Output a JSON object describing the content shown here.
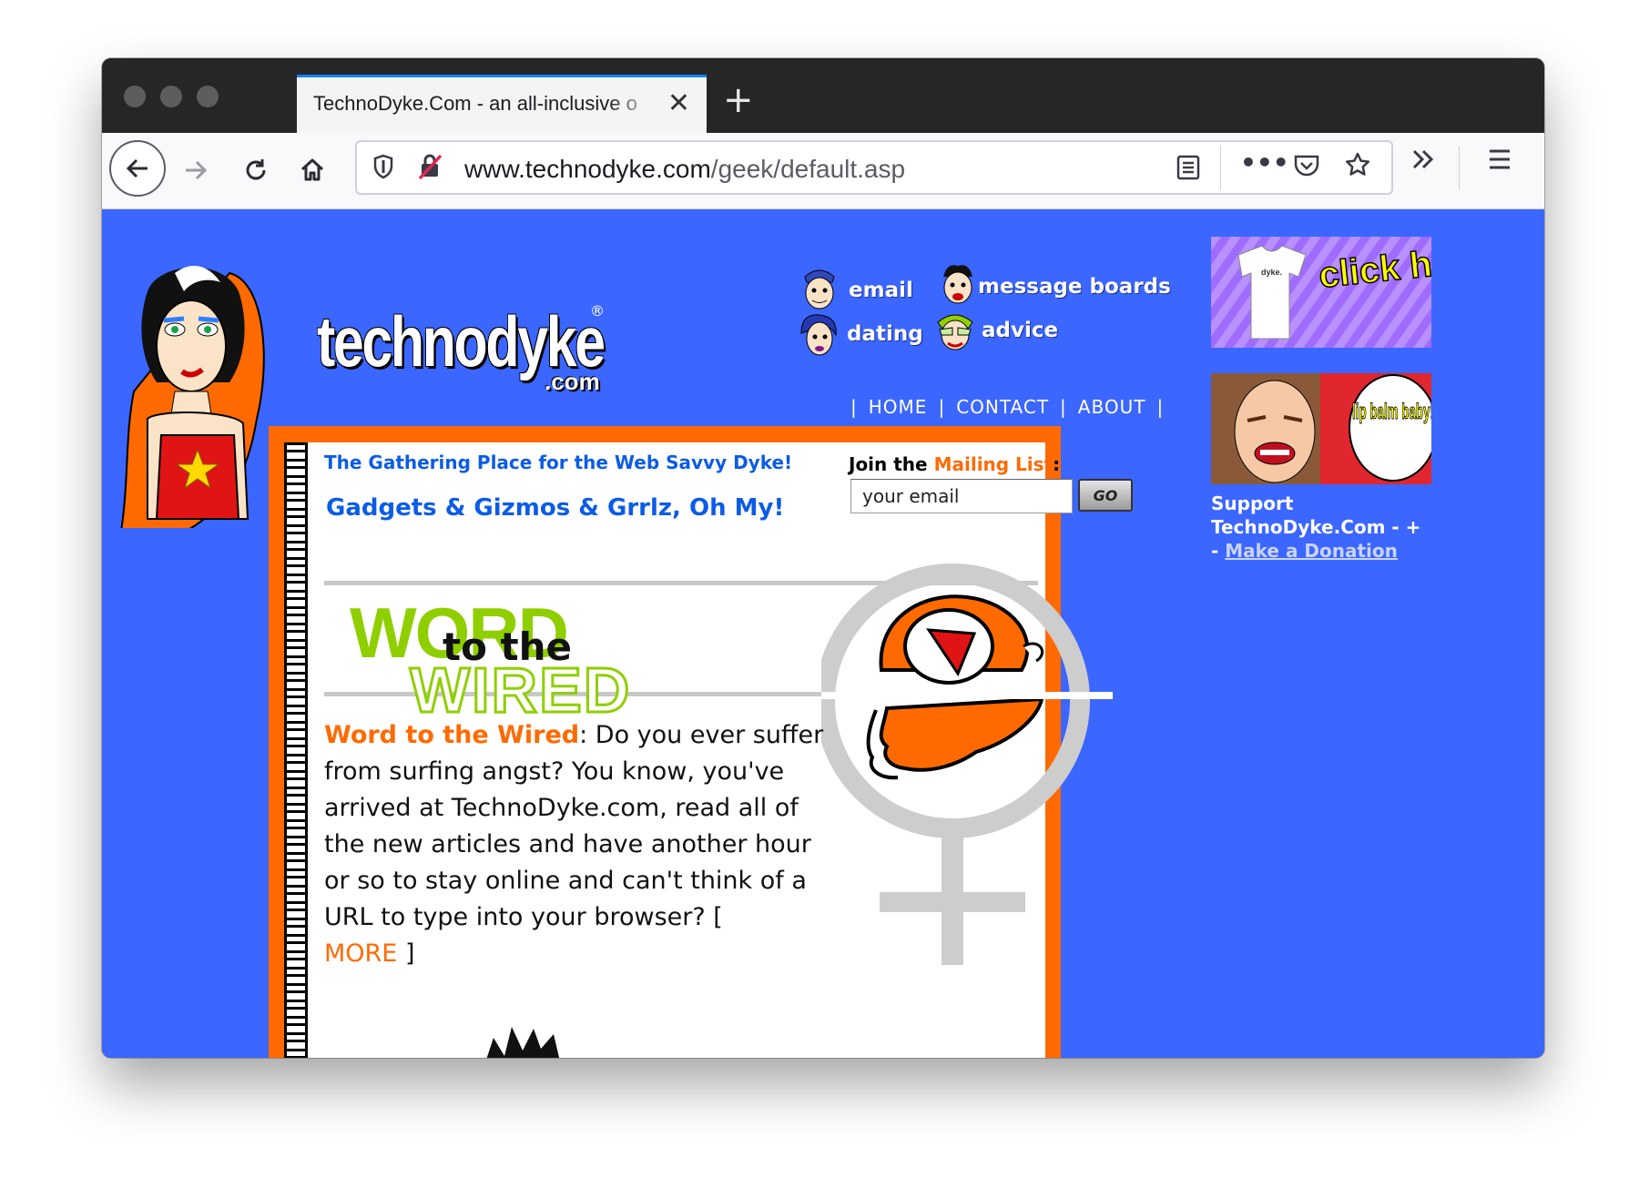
{
  "browser": {
    "tab_title": "TechnoDyke.Com - an all-inclusive o",
    "url_host": "www.technodyke.com",
    "url_path": "/geek/default.asp",
    "icons": [
      "back-icon",
      "forward-icon",
      "reload-icon",
      "home-icon",
      "shield-icon",
      "insecure-lock-icon",
      "reader-view-icon",
      "more-icon",
      "pocket-icon",
      "bookmark-star-icon",
      "overflow-icon",
      "menu-icon"
    ],
    "tab_active_color": "#0a84ff"
  },
  "site": {
    "logo_text": "technodyke",
    "logo_sub": ".com",
    "logo_reg": "®",
    "nav": {
      "email": "email",
      "message_boards": "message boards",
      "dating": "dating",
      "advice": "advice"
    },
    "topnav": {
      "home": "HOME",
      "contact": "CONTACT",
      "about": "ABOUT"
    },
    "tagline": "The Gathering Place for the Web Savvy Dyke!",
    "headline": "Gadgets & Gizmos & Grrlz, Oh My!",
    "mailing": {
      "join": "Join the",
      "list": "Mailing List",
      "colon": ":",
      "email_value": "your email",
      "go_label": "GO"
    },
    "wired_logo": {
      "word": "WORD",
      "to_the": "to the",
      "wired": "WIRED"
    },
    "article": {
      "lead": "Word to the Wired",
      "body": ": Do you ever suffer from surfing angst? You know, you've arrived at TechnoDyke.com, read all of the new articles and have another hour or so to stay online and can't think of a URL to type into your browser? [",
      "more": "MORE",
      "close": " ]"
    },
    "promo": {
      "click_here": "click here",
      "lip_balm": "lip balm baby!",
      "shirt_text": "dyke."
    },
    "support": {
      "line1": "Support TechnoDyke.Com - +",
      "dash": "- ",
      "donate": "Make a Donation"
    },
    "colors": {
      "page_bg": "#3b66ff",
      "accent_orange": "#ff6a00",
      "heading_blue": "#0b5ce6",
      "wired_green": "#8fcf00"
    }
  }
}
